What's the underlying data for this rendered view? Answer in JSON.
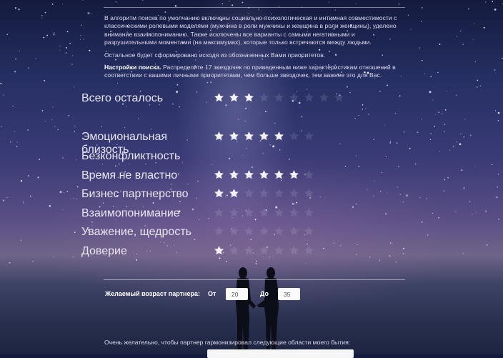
{
  "intro": {
    "paragraph1": "В алгоритм поиска по умолчанию включены социально-психологическая и интимная совместимости с классическими ролевыми моделями (мужчина в роли мужчины и женщина в роли женщины), уделено внимание взаимопониманию. Также исключены все варианты с самыми негативными и разрушительными моментами (на максимумах), которые только встречаются между людьми.",
    "paragraph2": "Остальное будет сформировано исходя из обозначенных Вами приоритетов.",
    "settings_bold": "Настройки поиска.",
    "settings_text": " Распределите 17 звездочек по приведенным ниже характеристикам отношений в соответствии с вашими личными приоритетами, чем больше звездочек, тем важнее это для Вас."
  },
  "rating": {
    "max_stars": 7,
    "rows": [
      {
        "key": "remaining",
        "label": "Всего осталось",
        "value": 3,
        "max": 9
      },
      {
        "key": "emotional",
        "label": "Эмоциональная близость",
        "value": 5,
        "max": 7
      },
      {
        "key": "conflict_free",
        "label": "Безконфликтность",
        "value": 0,
        "max": 0
      },
      {
        "key": "time",
        "label": "Время не властно",
        "value": 6,
        "max": 7
      },
      {
        "key": "business",
        "label": "Бизнес партнерство",
        "value": 2,
        "max": 7
      },
      {
        "key": "understanding",
        "label": "Взаимопонимание",
        "value": 0,
        "max": 7
      },
      {
        "key": "respect",
        "label": "Уважение, щедрость",
        "value": 0,
        "max": 7
      },
      {
        "key": "trust",
        "label": "Доверие",
        "value": 1,
        "max": 7
      }
    ]
  },
  "age": {
    "label": "Желаемый возраст партнера:",
    "from_label": "От",
    "from_value": "20",
    "to_label": "До",
    "to_value": "35"
  },
  "bottom": {
    "text": "Очень желательно, чтобы партнер гармонизировал следующие области моего бытия:"
  },
  "colors": {
    "star_on": "#f3f1fa",
    "star_off": "rgba(255,255,255,0.11)",
    "label": "#f4f2fb"
  }
}
